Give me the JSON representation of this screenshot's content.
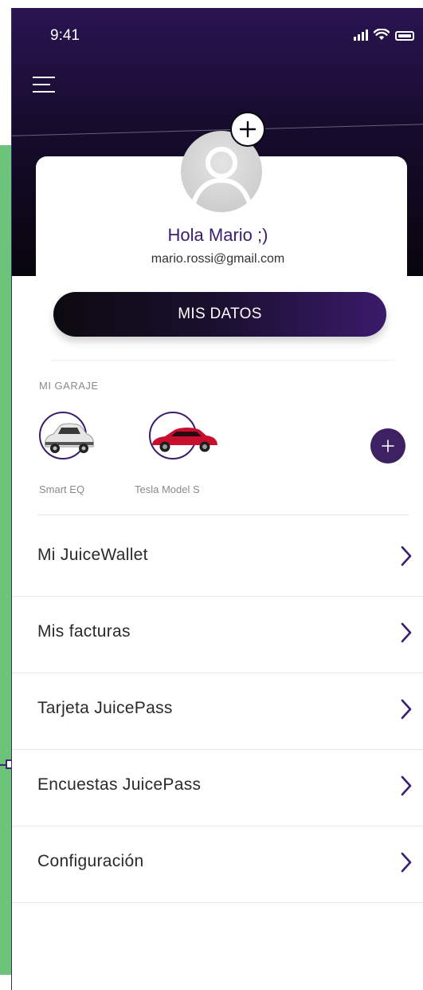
{
  "status_bar": {
    "time": "9:41"
  },
  "profile": {
    "greeting": "Hola Mario ;)",
    "email": "mario.rossi@gmail.com",
    "primary_button_label": "MIS DATOS"
  },
  "garage": {
    "title": "MI GARAJE",
    "cars": [
      {
        "label": "Smart EQ",
        "icon": "smart-car-icon",
        "color": "#e8e8e8"
      },
      {
        "label": "Tesla Model S",
        "icon": "tesla-car-icon",
        "color": "#c8102e"
      }
    ],
    "add_icon": "plus-icon"
  },
  "menu": [
    {
      "label": "Mi JuiceWallet",
      "icon": "chevron-right-icon"
    },
    {
      "label": "Mis facturas",
      "icon": "chevron-right-icon"
    },
    {
      "label": "Tarjeta JuicePass",
      "icon": "chevron-right-icon"
    },
    {
      "label": "Encuestas JuicePass",
      "icon": "chevron-right-icon"
    },
    {
      "label": "Configuración",
      "icon": "chevron-right-icon"
    }
  ],
  "theme": {
    "accent": "#3b1d6e",
    "header_dark": "#0a0714",
    "side_strip": "#6cc47a"
  }
}
